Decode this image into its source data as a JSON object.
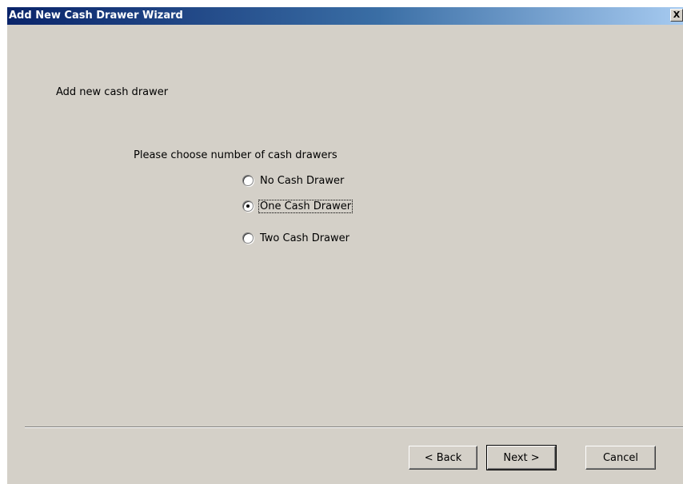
{
  "window": {
    "title": "Add New Cash Drawer Wizard",
    "close_label": "X"
  },
  "page": {
    "heading": "Add new cash drawer",
    "prompt": "Please choose number of cash drawers"
  },
  "options": [
    {
      "label": "No Cash Drawer",
      "checked": false
    },
    {
      "label": "One Cash Drawer",
      "checked": true
    },
    {
      "label": "Two Cash Drawer",
      "checked": false
    }
  ],
  "buttons": {
    "back": "< Back",
    "next": "Next >",
    "cancel": "Cancel"
  },
  "colors": {
    "face": "#d4d0c8",
    "title_start": "#0a246a",
    "title_end": "#a6caf0"
  }
}
